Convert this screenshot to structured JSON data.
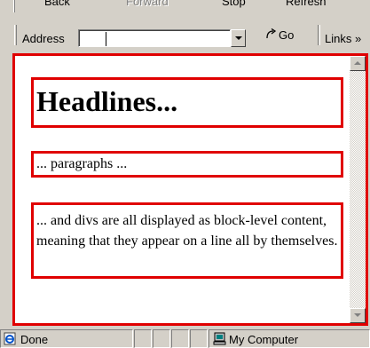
{
  "toolbar": {
    "back_label": "Back",
    "forward_label": "Forward",
    "stop_label": "Stop",
    "refresh_label": "Refresh"
  },
  "address_bar": {
    "label": "Address",
    "value": "",
    "go_label": "Go",
    "links_label": "Links »"
  },
  "page": {
    "heading": "Headlines...",
    "paragraph": "... paragraphs ...",
    "div_text": "... and divs are all displayed as block-level content, meaning that they appear on a line all by themselves."
  },
  "status_bar": {
    "status_text": "Done",
    "zone_text": "My Computer"
  },
  "colors": {
    "chrome": "#d4d0c8",
    "outline": "#e00000"
  },
  "icons": [
    "ie-page-icon",
    "go-arrow-icon",
    "my-computer-icon",
    "dropdown-arrow-icon",
    "scroll-up-icon",
    "scroll-down-icon"
  ]
}
